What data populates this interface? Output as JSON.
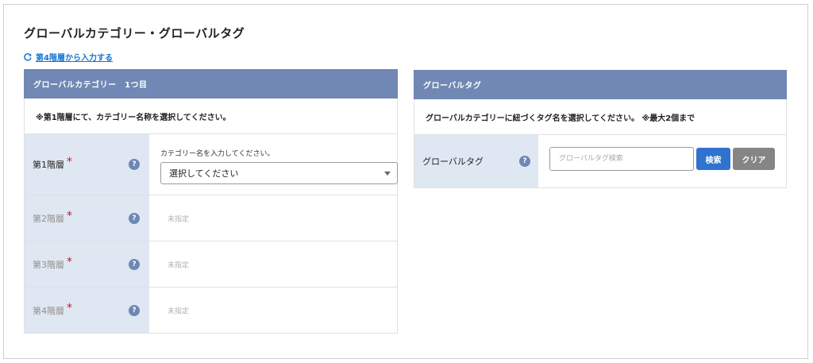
{
  "page": {
    "title": "グローバルカテゴリー・グローバルタグ",
    "reset_link": "第4階層から入力する"
  },
  "category_panel": {
    "header": "グローバルカテゴリー　1つ目",
    "note": "※第1階層にて、カテゴリー名称を選択してください。",
    "rows": [
      {
        "label": "第1階層",
        "required_mark": "*",
        "help": "?",
        "hint": "カテゴリー名を入力してください。",
        "select_value": "選択してください"
      },
      {
        "label": "第2階層",
        "required_mark": "*",
        "help": "?",
        "value": "未指定"
      },
      {
        "label": "第3階層",
        "required_mark": "*",
        "help": "?",
        "value": "未指定"
      },
      {
        "label": "第4階層",
        "required_mark": "*",
        "help": "?",
        "value": "未指定"
      }
    ]
  },
  "tag_panel": {
    "header": "グローバルタグ",
    "note": "グローバルカテゴリーに紐づくタグ名を選択してください。 ※最大2個まで",
    "row_label": "グローバルタグ",
    "help": "?",
    "search_placeholder": "グローバルタグ検索",
    "search_button": "検索",
    "clear_button": "クリア"
  },
  "colors": {
    "header_bg": "#7188b4",
    "label_bg": "#dfe7f2",
    "required": "#d0161c",
    "link": "#1a73d1",
    "search_button": "#2f73cf",
    "clear_button": "#858585"
  },
  "icons": {
    "reset": "refresh-icon",
    "help": "question-circle-icon",
    "dropdown": "caret-down-icon"
  }
}
